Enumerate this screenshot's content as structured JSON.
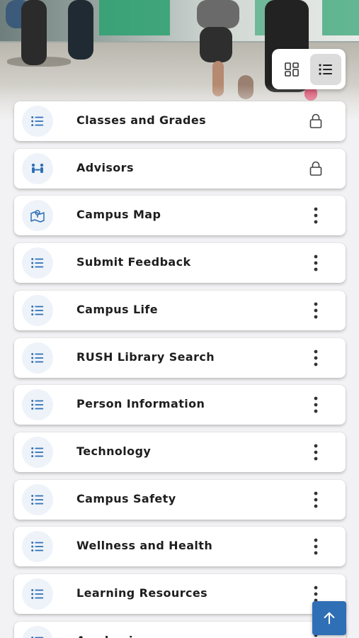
{
  "hero": {
    "image": "campus-photo"
  },
  "view_toggle": {
    "options": [
      {
        "name": "grid-view",
        "icon": "grid-icon",
        "active": false
      },
      {
        "name": "list-view",
        "icon": "list-icon",
        "active": true
      }
    ]
  },
  "colors": {
    "accent": "#2f6fb5",
    "icon_bg": "#eef3f9",
    "card": "#ffffff",
    "text": "#1e1e1e",
    "page_bg": "#f2f2f4"
  },
  "items": [
    {
      "label": "Classes and Grades",
      "icon": "list-icon",
      "action": "lock-icon"
    },
    {
      "label": "Advisors",
      "icon": "people-icon",
      "action": "lock-icon"
    },
    {
      "label": "Campus Map",
      "icon": "map-icon",
      "action": "more-vertical-icon"
    },
    {
      "label": "Submit Feedback",
      "icon": "list-icon",
      "action": "more-vertical-icon"
    },
    {
      "label": "Campus Life",
      "icon": "list-icon",
      "action": "more-vertical-icon"
    },
    {
      "label": "RUSH Library Search",
      "icon": "list-icon",
      "action": "more-vertical-icon"
    },
    {
      "label": "Person Information",
      "icon": "list-icon",
      "action": "more-vertical-icon"
    },
    {
      "label": "Technology",
      "icon": "list-icon",
      "action": "more-vertical-icon"
    },
    {
      "label": "Campus Safety",
      "icon": "list-icon",
      "action": "more-vertical-icon"
    },
    {
      "label": "Wellness and Health",
      "icon": "list-icon",
      "action": "more-vertical-icon"
    },
    {
      "label": "Learning Resources",
      "icon": "list-icon",
      "action": "more-vertical-icon"
    },
    {
      "label": "Academics",
      "icon": "list-icon",
      "action": "more-vertical-icon"
    }
  ],
  "fab": {
    "icon": "arrow-up-icon"
  }
}
